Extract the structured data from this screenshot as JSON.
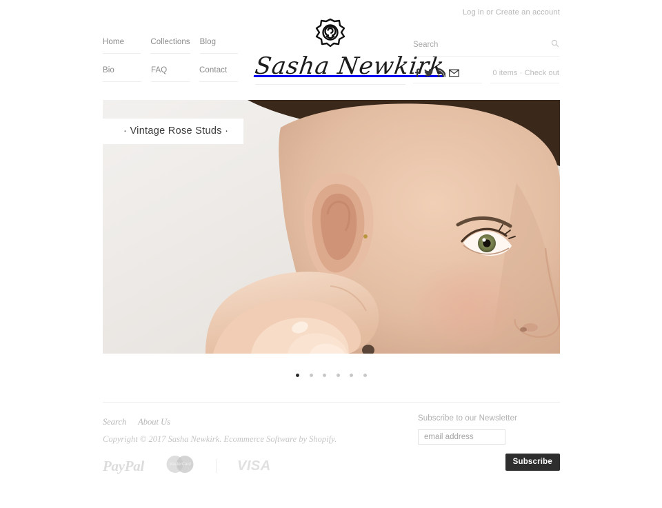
{
  "topbar": {
    "login_label": "Log in",
    "or_label": "or",
    "create_label": "Create an account"
  },
  "nav": {
    "items": [
      {
        "label": "Home"
      },
      {
        "label": "Collections"
      },
      {
        "label": "Blog"
      },
      {
        "label": "Bio"
      },
      {
        "label": "FAQ"
      },
      {
        "label": "Contact"
      }
    ]
  },
  "logo": {
    "brand": "Sasha Newkirk",
    "icon": "rose-icon"
  },
  "search": {
    "placeholder": "Search",
    "value": "",
    "icon": "search-icon"
  },
  "social": {
    "items": [
      {
        "name": "facebook-icon",
        "glyph": "f"
      },
      {
        "name": "twitter-icon",
        "glyph": "t"
      },
      {
        "name": "rss-icon",
        "glyph": "r"
      },
      {
        "name": "email-icon",
        "glyph": "m"
      }
    ]
  },
  "cart": {
    "items_label": "0 items",
    "separator": "·",
    "checkout_label": "Check out"
  },
  "hero": {
    "caption": "· Vintage Rose Studs ·",
    "alt": "Woman wearing vintage rose stud earring",
    "slides_total": 6,
    "active_slide": 1
  },
  "footer": {
    "links": [
      {
        "label": "Search"
      },
      {
        "label": "About Us"
      }
    ],
    "copyright_prefix": "Copyright © 2017 Sasha Newkirk.",
    "ecommerce_text": "Ecommerce Software by Shopify.",
    "payments": [
      {
        "name": "paypal-logo",
        "label": "PayPal"
      },
      {
        "name": "mastercard-logo",
        "label": "MasterCard"
      },
      {
        "name": "visa-logo",
        "label": "VISA"
      }
    ]
  },
  "newsletter": {
    "title": "Subscribe to our Newsletter",
    "input_placeholder": "email address",
    "input_value": "",
    "button_label": "Subscribe"
  },
  "colors": {
    "accent_dark": "#2e2e2e",
    "text_muted": "#8d8d8d",
    "border": "#ededed"
  }
}
